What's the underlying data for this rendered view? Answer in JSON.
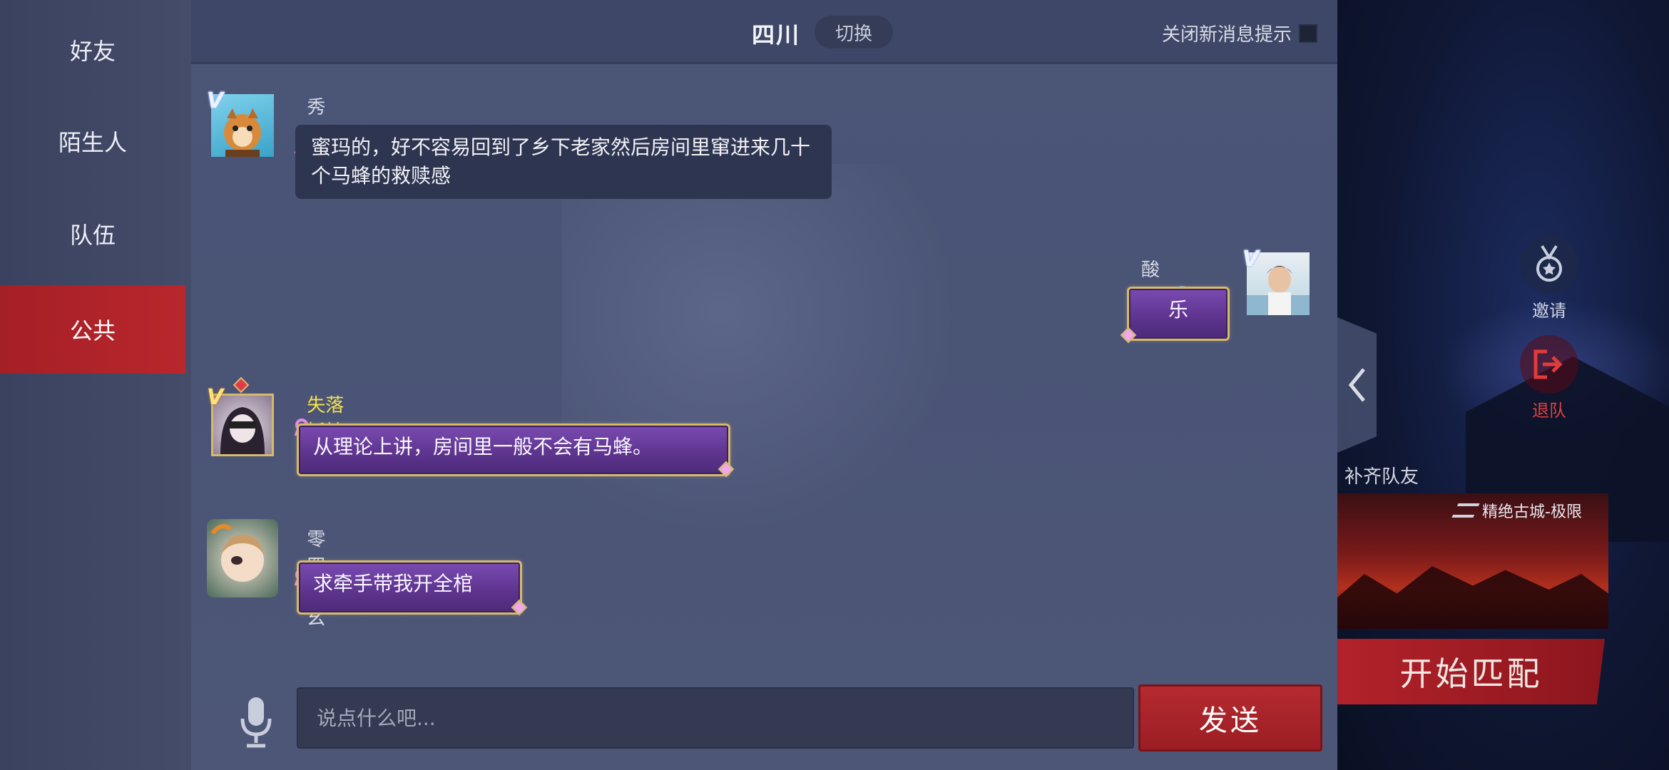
{
  "sidebar": {
    "tabs": [
      {
        "label": "好友",
        "active": false
      },
      {
        "label": "陌生人",
        "active": false
      },
      {
        "label": "队伍",
        "active": false
      },
      {
        "label": "公共",
        "active": true
      }
    ]
  },
  "header": {
    "channel": "四川",
    "switch_label": "切换",
    "mute_label": "关闭新消息提示"
  },
  "messages": [
    {
      "sender": "秀叭宝宝",
      "side": "left",
      "style": "plain",
      "text": "蜜玛的，好不容易回到了乡下老家然后房间里窜进来几十个马蜂的救赎感"
    },
    {
      "sender": "酸布丁",
      "side": "right",
      "style": "fancy",
      "gender": "♂",
      "text": "乐"
    },
    {
      "sender": "失落妖神l68",
      "side": "left",
      "style": "fancy",
      "name_color": "#f3e24a",
      "text": "从理论上讲，房间里一般不会有马蜂。"
    },
    {
      "sender": "零四洞幺",
      "side": "left",
      "style": "fancy",
      "text": "求牵手带我开全棺"
    }
  ],
  "input": {
    "placeholder": "说点什么吧...",
    "send_label": "发送"
  },
  "game_panel": {
    "invite_label": "邀请",
    "leave_label": "退队",
    "fill_team_label": "补齐队友",
    "map_name": "精绝古城-极限",
    "start_label": "开始匹配"
  },
  "colors": {
    "active_tab": "#b8272c",
    "pin_accent": "#e58ae9",
    "gold_border": "#d6b96a",
    "send_button": "#b52a30"
  }
}
